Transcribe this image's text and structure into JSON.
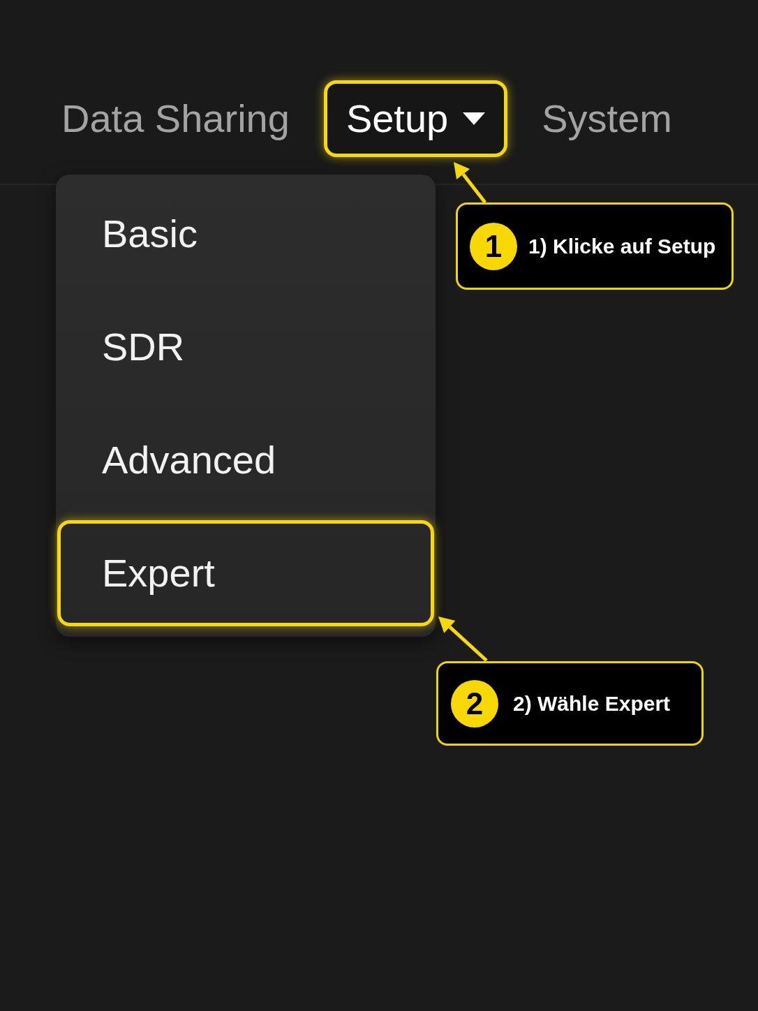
{
  "nav": {
    "items": [
      {
        "label": "Data Sharing",
        "kind": "link",
        "selected": false,
        "highlighted": false
      },
      {
        "label": "Setup",
        "kind": "dropdown",
        "selected": true,
        "highlighted": true,
        "menu": [
          {
            "label": "Basic",
            "highlighted": false
          },
          {
            "label": "SDR",
            "highlighted": false
          },
          {
            "label": "Advanced",
            "highlighted": false
          },
          {
            "label": "Expert",
            "highlighted": true
          }
        ]
      },
      {
        "label": "System",
        "kind": "link",
        "selected": false,
        "highlighted": false
      }
    ]
  },
  "callouts": [
    {
      "number": "1",
      "text": "1) Klicke auf Setup"
    },
    {
      "number": "2",
      "text": "2) Wähle Expert"
    }
  ]
}
